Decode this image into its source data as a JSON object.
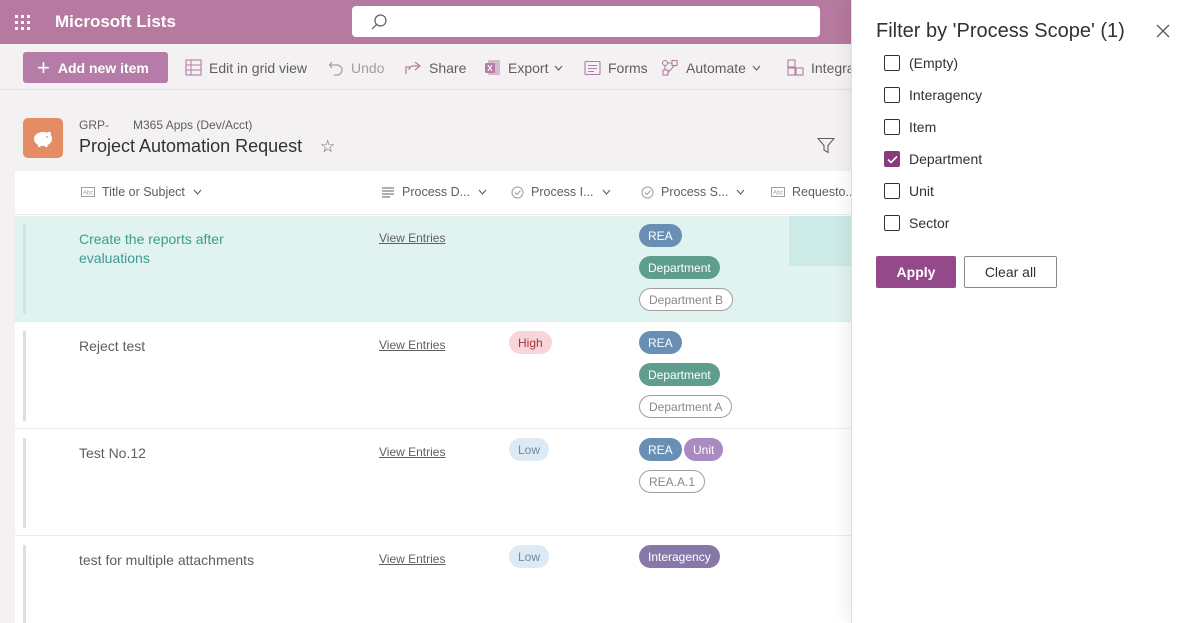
{
  "app": {
    "name": "Microsoft Lists"
  },
  "search": {
    "placeholder": ""
  },
  "toolbar": {
    "add_new_item": "Add new item",
    "edit_grid": "Edit in grid view",
    "undo": "Undo",
    "share": "Share",
    "export": "Export",
    "forms": "Forms",
    "automate": "Automate",
    "integrate": "Integra"
  },
  "list": {
    "breadcrumb_group": "GRP-",
    "breadcrumb_site": "M365 Apps (Dev/Acct)",
    "title": "Project Automation Request"
  },
  "columns": [
    "Title or Subject",
    "Process D...",
    "Process I...",
    "Process S...",
    "Requesto..."
  ],
  "rows": [
    {
      "title": "Create the reports after evaluations",
      "link": "View Entries",
      "priority": "",
      "scope": [
        "REA",
        "Department",
        "Department B"
      ],
      "selected": true
    },
    {
      "title": "Reject test",
      "link": "View Entries",
      "priority": "High",
      "scope": [
        "REA",
        "Department",
        "Department A"
      ],
      "selected": false
    },
    {
      "title": "Test No.12",
      "link": "View Entries",
      "priority": "Low",
      "scope": [
        "REA",
        "Unit",
        "REA.A.1"
      ],
      "selected": false
    },
    {
      "title": "test for multiple attachments",
      "link": "View Entries",
      "priority": "Low",
      "scope": [
        "Interagency"
      ],
      "selected": false
    }
  ],
  "filter_panel": {
    "title": "Filter by 'Process Scope' (1)",
    "options": [
      {
        "label": "(Empty)",
        "checked": false
      },
      {
        "label": "Interagency",
        "checked": false
      },
      {
        "label": "Item",
        "checked": false
      },
      {
        "label": "Department",
        "checked": true
      },
      {
        "label": "Unit",
        "checked": false
      },
      {
        "label": "Sector",
        "checked": false
      }
    ],
    "apply_label": "Apply",
    "clear_label": "Clear all"
  },
  "colors": {
    "suite_bar": "#b6799f",
    "accent": "#944a8a",
    "selected_row": "#e1f3f0"
  }
}
